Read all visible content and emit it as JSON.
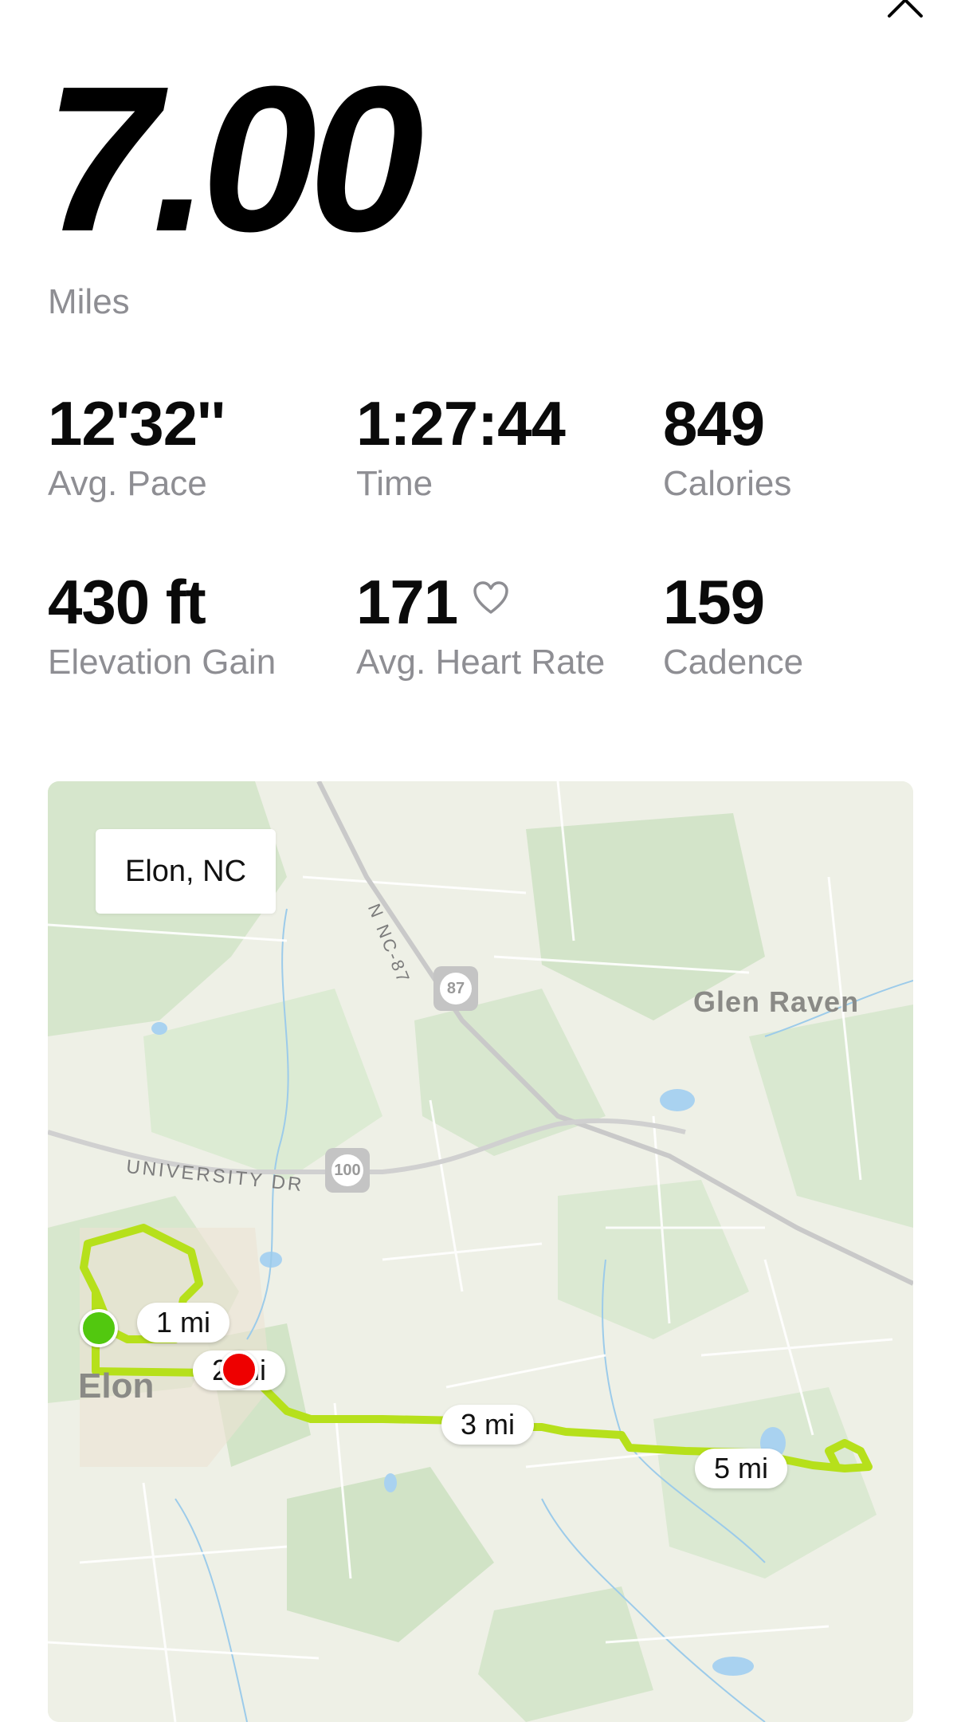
{
  "header": {
    "close_icon": "close-icon"
  },
  "summary": {
    "distance": "7.00",
    "unit": "Miles"
  },
  "stats": [
    {
      "value": "12'32''",
      "label": "Avg. Pace"
    },
    {
      "value": "1:27:44",
      "label": "Time"
    },
    {
      "value": "849",
      "label": "Calories"
    },
    {
      "value": "430 ft",
      "label": "Elevation Gain"
    },
    {
      "value": "171",
      "label": "Avg. Heart Rate",
      "icon": "heart-outline-icon"
    },
    {
      "value": "159",
      "label": "Cadence"
    }
  ],
  "map": {
    "location": "Elon, NC",
    "towns": {
      "glen_raven": "Glen Raven",
      "elon": "Elon"
    },
    "roads": {
      "nc87": "N NC-87",
      "university": "UNIVERSITY DR"
    },
    "shields": {
      "nc87": "87",
      "us100": "100"
    },
    "mile_markers": [
      "1 mi",
      "2 mi",
      "3 mi",
      "5 mi"
    ],
    "route_color": "#b6e01b",
    "start_color": "#52c80f",
    "end_color": "#ee0000"
  }
}
